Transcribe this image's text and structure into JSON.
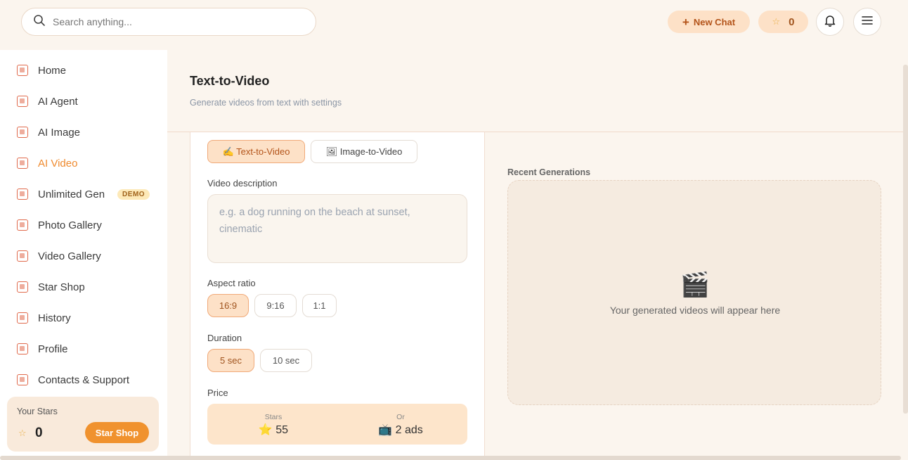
{
  "header": {
    "search_placeholder": "Search anything...",
    "new_chat_label": "New Chat",
    "stars_count": "0"
  },
  "sidebar": {
    "items": [
      {
        "label": "Home",
        "icon": "home-icon"
      },
      {
        "label": "AI Agent",
        "icon": "agent-icon"
      },
      {
        "label": "AI Image",
        "icon": "image-icon"
      },
      {
        "label": "AI Video",
        "icon": "video-icon",
        "active": true
      },
      {
        "label": "Unlimited Gen",
        "icon": "unlimited-icon",
        "badge": "DEMO"
      },
      {
        "label": "Photo Gallery",
        "icon": "photo-gallery-icon"
      },
      {
        "label": "Video Gallery",
        "icon": "video-gallery-icon"
      },
      {
        "label": "Star Shop",
        "icon": "shop-icon"
      },
      {
        "label": "History",
        "icon": "history-icon"
      },
      {
        "label": "Profile",
        "icon": "profile-icon"
      },
      {
        "label": "Contacts & Support",
        "icon": "support-icon"
      }
    ],
    "your_stars": {
      "label": "Your Stars",
      "value": "0",
      "button_label": "Star Shop"
    }
  },
  "main": {
    "title": "Text-to-Video",
    "subtitle": "Generate videos from text with settings",
    "mode_tabs": [
      {
        "label": "✍ Text-to-Video",
        "active": true
      },
      {
        "label": "🖼 Image-to-Video",
        "active": false
      }
    ],
    "description": {
      "label": "Video description",
      "placeholder": "e.g. a dog running on the beach at sunset, cinematic"
    },
    "aspect_ratio": {
      "label": "Aspect ratio",
      "options": [
        "16:9",
        "9:16",
        "1:1"
      ],
      "selected": "16:9"
    },
    "duration": {
      "label": "Duration",
      "options": [
        "5 sec",
        "10 sec"
      ],
      "selected": "5 sec"
    },
    "price": {
      "label": "Price",
      "stars_caption": "Stars",
      "stars_value": "⭐ 55",
      "or_caption": "Or",
      "ads_value": "📺 2 ads"
    },
    "recent": {
      "title": "Recent Generations",
      "empty_icon": "🎬",
      "empty_text": "Your generated videos will appear here"
    }
  },
  "colors": {
    "accent": "#ef8a2e",
    "accent_soft": "#fde1c7",
    "background": "#fbf5ee"
  }
}
